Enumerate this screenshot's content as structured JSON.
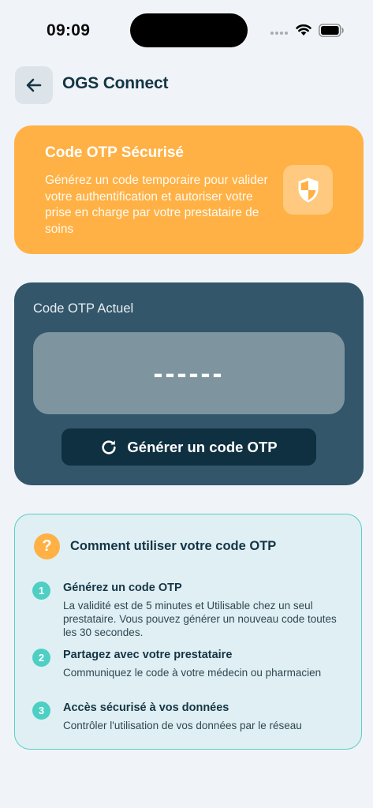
{
  "status_bar": {
    "time": "09:09"
  },
  "header": {
    "title": "OGS Connect"
  },
  "info_card": {
    "title": "Code OTP Sécurisé",
    "description": "Générez un code temporaire pour valider votre authentification et autoriser votre prise en charge par votre prestataire de soins",
    "icon": "shield-icon",
    "color": "#ffb145"
  },
  "otp_card": {
    "label": "Code OTP Actuel",
    "code": "------",
    "button_label": "Générer un code OTP",
    "button_icon": "refresh-icon",
    "color": "#33566a"
  },
  "help_card": {
    "icon": "?",
    "title": "Comment utiliser votre code OTP",
    "steps": [
      {
        "number": "1",
        "title": "Générez un code OTP",
        "description": "La validité est de 5 minutes et Utilisable chez un seul prestataire. Vous pouvez générer un nouveau code toutes les 30 secondes."
      },
      {
        "number": "2",
        "title": "Partagez avec votre prestataire",
        "description": "Communiquez le code à votre médecin ou pharmacien"
      },
      {
        "number": "3",
        "title": "Accès sécurisé à vos données",
        "description": "Contrôler l'utilisation de vos données par le réseau"
      }
    ],
    "accent": "#4ecfc3"
  }
}
